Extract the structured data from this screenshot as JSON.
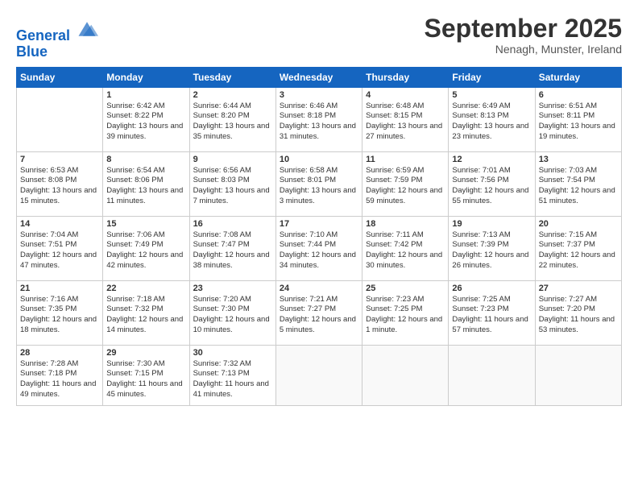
{
  "header": {
    "logo_line1": "General",
    "logo_line2": "Blue",
    "month": "September 2025",
    "location": "Nenagh, Munster, Ireland"
  },
  "days_of_week": [
    "Sunday",
    "Monday",
    "Tuesday",
    "Wednesday",
    "Thursday",
    "Friday",
    "Saturday"
  ],
  "weeks": [
    [
      {
        "day": "",
        "sunrise": "",
        "sunset": "",
        "daylight": ""
      },
      {
        "day": "1",
        "sunrise": "Sunrise: 6:42 AM",
        "sunset": "Sunset: 8:22 PM",
        "daylight": "Daylight: 13 hours and 39 minutes."
      },
      {
        "day": "2",
        "sunrise": "Sunrise: 6:44 AM",
        "sunset": "Sunset: 8:20 PM",
        "daylight": "Daylight: 13 hours and 35 minutes."
      },
      {
        "day": "3",
        "sunrise": "Sunrise: 6:46 AM",
        "sunset": "Sunset: 8:18 PM",
        "daylight": "Daylight: 13 hours and 31 minutes."
      },
      {
        "day": "4",
        "sunrise": "Sunrise: 6:48 AM",
        "sunset": "Sunset: 8:15 PM",
        "daylight": "Daylight: 13 hours and 27 minutes."
      },
      {
        "day": "5",
        "sunrise": "Sunrise: 6:49 AM",
        "sunset": "Sunset: 8:13 PM",
        "daylight": "Daylight: 13 hours and 23 minutes."
      },
      {
        "day": "6",
        "sunrise": "Sunrise: 6:51 AM",
        "sunset": "Sunset: 8:11 PM",
        "daylight": "Daylight: 13 hours and 19 minutes."
      }
    ],
    [
      {
        "day": "7",
        "sunrise": "Sunrise: 6:53 AM",
        "sunset": "Sunset: 8:08 PM",
        "daylight": "Daylight: 13 hours and 15 minutes."
      },
      {
        "day": "8",
        "sunrise": "Sunrise: 6:54 AM",
        "sunset": "Sunset: 8:06 PM",
        "daylight": "Daylight: 13 hours and 11 minutes."
      },
      {
        "day": "9",
        "sunrise": "Sunrise: 6:56 AM",
        "sunset": "Sunset: 8:03 PM",
        "daylight": "Daylight: 13 hours and 7 minutes."
      },
      {
        "day": "10",
        "sunrise": "Sunrise: 6:58 AM",
        "sunset": "Sunset: 8:01 PM",
        "daylight": "Daylight: 13 hours and 3 minutes."
      },
      {
        "day": "11",
        "sunrise": "Sunrise: 6:59 AM",
        "sunset": "Sunset: 7:59 PM",
        "daylight": "Daylight: 12 hours and 59 minutes."
      },
      {
        "day": "12",
        "sunrise": "Sunrise: 7:01 AM",
        "sunset": "Sunset: 7:56 PM",
        "daylight": "Daylight: 12 hours and 55 minutes."
      },
      {
        "day": "13",
        "sunrise": "Sunrise: 7:03 AM",
        "sunset": "Sunset: 7:54 PM",
        "daylight": "Daylight: 12 hours and 51 minutes."
      }
    ],
    [
      {
        "day": "14",
        "sunrise": "Sunrise: 7:04 AM",
        "sunset": "Sunset: 7:51 PM",
        "daylight": "Daylight: 12 hours and 47 minutes."
      },
      {
        "day": "15",
        "sunrise": "Sunrise: 7:06 AM",
        "sunset": "Sunset: 7:49 PM",
        "daylight": "Daylight: 12 hours and 42 minutes."
      },
      {
        "day": "16",
        "sunrise": "Sunrise: 7:08 AM",
        "sunset": "Sunset: 7:47 PM",
        "daylight": "Daylight: 12 hours and 38 minutes."
      },
      {
        "day": "17",
        "sunrise": "Sunrise: 7:10 AM",
        "sunset": "Sunset: 7:44 PM",
        "daylight": "Daylight: 12 hours and 34 minutes."
      },
      {
        "day": "18",
        "sunrise": "Sunrise: 7:11 AM",
        "sunset": "Sunset: 7:42 PM",
        "daylight": "Daylight: 12 hours and 30 minutes."
      },
      {
        "day": "19",
        "sunrise": "Sunrise: 7:13 AM",
        "sunset": "Sunset: 7:39 PM",
        "daylight": "Daylight: 12 hours and 26 minutes."
      },
      {
        "day": "20",
        "sunrise": "Sunrise: 7:15 AM",
        "sunset": "Sunset: 7:37 PM",
        "daylight": "Daylight: 12 hours and 22 minutes."
      }
    ],
    [
      {
        "day": "21",
        "sunrise": "Sunrise: 7:16 AM",
        "sunset": "Sunset: 7:35 PM",
        "daylight": "Daylight: 12 hours and 18 minutes."
      },
      {
        "day": "22",
        "sunrise": "Sunrise: 7:18 AM",
        "sunset": "Sunset: 7:32 PM",
        "daylight": "Daylight: 12 hours and 14 minutes."
      },
      {
        "day": "23",
        "sunrise": "Sunrise: 7:20 AM",
        "sunset": "Sunset: 7:30 PM",
        "daylight": "Daylight: 12 hours and 10 minutes."
      },
      {
        "day": "24",
        "sunrise": "Sunrise: 7:21 AM",
        "sunset": "Sunset: 7:27 PM",
        "daylight": "Daylight: 12 hours and 5 minutes."
      },
      {
        "day": "25",
        "sunrise": "Sunrise: 7:23 AM",
        "sunset": "Sunset: 7:25 PM",
        "daylight": "Daylight: 12 hours and 1 minute."
      },
      {
        "day": "26",
        "sunrise": "Sunrise: 7:25 AM",
        "sunset": "Sunset: 7:23 PM",
        "daylight": "Daylight: 11 hours and 57 minutes."
      },
      {
        "day": "27",
        "sunrise": "Sunrise: 7:27 AM",
        "sunset": "Sunset: 7:20 PM",
        "daylight": "Daylight: 11 hours and 53 minutes."
      }
    ],
    [
      {
        "day": "28",
        "sunrise": "Sunrise: 7:28 AM",
        "sunset": "Sunset: 7:18 PM",
        "daylight": "Daylight: 11 hours and 49 minutes."
      },
      {
        "day": "29",
        "sunrise": "Sunrise: 7:30 AM",
        "sunset": "Sunset: 7:15 PM",
        "daylight": "Daylight: 11 hours and 45 minutes."
      },
      {
        "day": "30",
        "sunrise": "Sunrise: 7:32 AM",
        "sunset": "Sunset: 7:13 PM",
        "daylight": "Daylight: 11 hours and 41 minutes."
      },
      {
        "day": "",
        "sunrise": "",
        "sunset": "",
        "daylight": ""
      },
      {
        "day": "",
        "sunrise": "",
        "sunset": "",
        "daylight": ""
      },
      {
        "day": "",
        "sunrise": "",
        "sunset": "",
        "daylight": ""
      },
      {
        "day": "",
        "sunrise": "",
        "sunset": "",
        "daylight": ""
      }
    ]
  ]
}
